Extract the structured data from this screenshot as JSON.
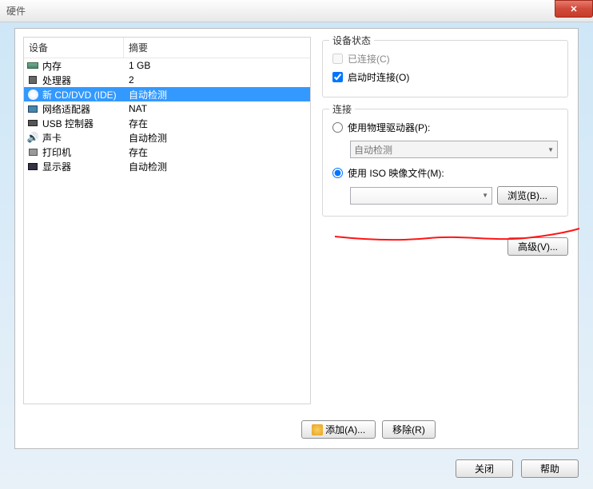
{
  "titlebar": {
    "title": "硬件"
  },
  "device_table": {
    "headers": {
      "device": "设备",
      "summary": "摘要"
    },
    "rows": [
      {
        "name": "内存",
        "summary": "1 GB",
        "icon": "memory-icon",
        "selected": false
      },
      {
        "name": "处理器",
        "summary": "2",
        "icon": "cpu-icon",
        "selected": false
      },
      {
        "name": "新 CD/DVD (IDE)",
        "summary": "自动检测",
        "icon": "cd-icon",
        "selected": true
      },
      {
        "name": "网络适配器",
        "summary": "NAT",
        "icon": "nic-icon",
        "selected": false
      },
      {
        "name": "USB 控制器",
        "summary": "存在",
        "icon": "usb-icon",
        "selected": false
      },
      {
        "name": "声卡",
        "summary": "自动检测",
        "icon": "sound-icon",
        "selected": false
      },
      {
        "name": "打印机",
        "summary": "存在",
        "icon": "printer-icon",
        "selected": false
      },
      {
        "name": "显示器",
        "summary": "自动检测",
        "icon": "display-icon",
        "selected": false
      }
    ]
  },
  "right": {
    "status": {
      "title": "设备状态",
      "connected_label": "已连接(C)",
      "connected_checked": false,
      "connected_enabled": false,
      "connect_on_start_label": "启动时连接(O)",
      "connect_on_start_checked": true
    },
    "connection": {
      "title": "连接",
      "physical_label": "使用物理驱动器(P):",
      "physical_selected": false,
      "physical_dropdown": "自动检测",
      "iso_label": "使用 ISO 映像文件(M):",
      "iso_selected": true,
      "iso_path": "",
      "browse_label": "浏览(B)..."
    },
    "advanced_label": "高级(V)..."
  },
  "bottom_buttons": {
    "add_label": "添加(A)...",
    "remove_label": "移除(R)"
  },
  "footer": {
    "close_label": "关闭",
    "help_label": "帮助"
  }
}
